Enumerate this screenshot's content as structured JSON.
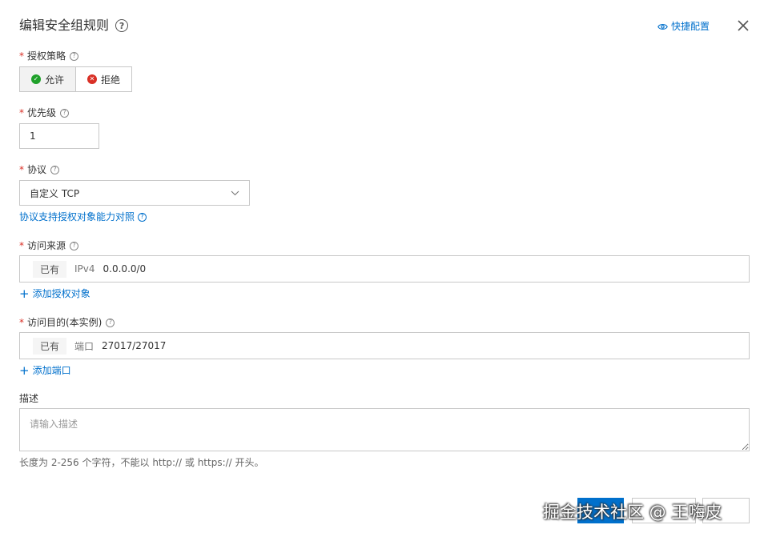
{
  "dialog": {
    "title": "编辑安全组规则",
    "quick_config_label": "快捷配置"
  },
  "policy": {
    "label": "授权策略",
    "options": [
      "允许",
      "拒绝"
    ],
    "selected": "允许"
  },
  "priority": {
    "label": "优先级",
    "value": "1"
  },
  "protocol": {
    "label": "协议",
    "selected": "自定义 TCP",
    "compare_link": "协议支持授权对象能力对照"
  },
  "source": {
    "label": "访问来源",
    "tag": "已有",
    "type": "IPv4",
    "value": "0.0.0.0/0",
    "add_label": "添加授权对象"
  },
  "destination": {
    "label": "访问目的(本实例)",
    "tag": "已有",
    "type": "端口",
    "value": "27017/27017",
    "add_label": "添加端口"
  },
  "description": {
    "label": "描述",
    "placeholder": "请输入描述",
    "hint": "长度为 2-256 个字符，不能以 http:// 或 https:// 开头。"
  },
  "watermark": "掘金技术社区 @ 王嗨皮",
  "colors": {
    "primary": "#0070cc",
    "required": "#d93026",
    "allow": "#1fa12a",
    "deny": "#d93026"
  }
}
